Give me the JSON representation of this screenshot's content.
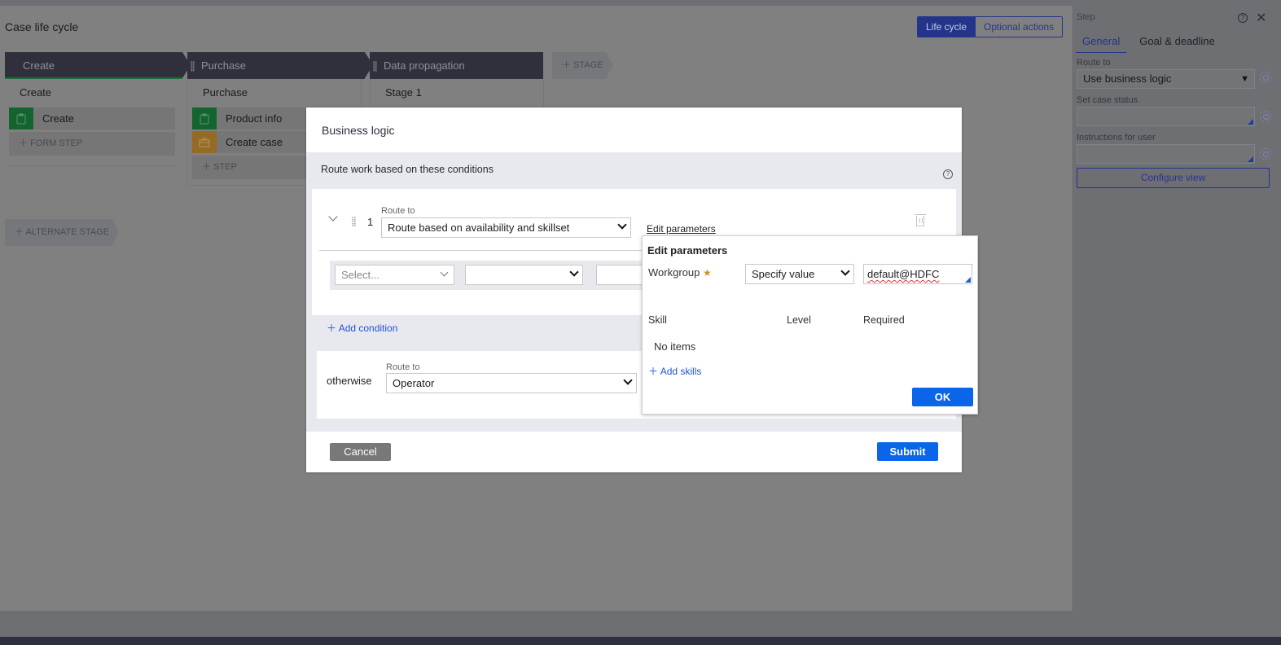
{
  "canvas": {
    "title": "Case life cycle",
    "view_toggle": {
      "active": "Life cycle",
      "inactive": "Optional actions"
    },
    "stages": [
      {
        "name": "Create",
        "processes": [
          {
            "title": "Create",
            "steps": [
              {
                "label": "Create",
                "icon": "clipboard-icon",
                "color": "#13642f"
              }
            ],
            "add_label": "FORM STEP"
          }
        ]
      },
      {
        "name": "Purchase",
        "processes": [
          {
            "title": "Purchase",
            "steps": [
              {
                "label": "Product info",
                "icon": "clipboard-icon",
                "color": "#13642f"
              },
              {
                "label": "Create case",
                "icon": "briefcase-icon",
                "color": "#946a25"
              }
            ],
            "add_label": "STEP"
          }
        ]
      },
      {
        "name": "Data propagation",
        "processes": [
          {
            "title": "Stage 1"
          }
        ]
      }
    ],
    "add_stage_label": "STAGE",
    "add_alternate_stage_label": "ALTERNATE STAGE"
  },
  "panel": {
    "title": "Step",
    "tabs": [
      "General",
      "Goal & deadline"
    ],
    "active_tab": "General",
    "route_to_label": "Route to",
    "route_to_value": "Use business logic",
    "case_status_label": "Set case status",
    "case_status_value": "",
    "instructions_label": "Instructions for user",
    "instructions_value": "",
    "configure_view_label": "Configure view"
  },
  "modal": {
    "title": "Business logic",
    "section_label": "Route work based on these conditions",
    "condition": {
      "index": "1",
      "route_to_label": "Route to",
      "route_to_value": "Route based on availability and skillset",
      "edit_parameters_label": "Edit parameters",
      "field_placeholder": "Select...",
      "operator_value": "",
      "value": ""
    },
    "add_condition_label": "Add condition",
    "otherwise": {
      "label": "otherwise",
      "route_to_label": "Route to",
      "route_to_value": "Operator"
    },
    "cancel_label": "Cancel",
    "submit_label": "Submit"
  },
  "popover": {
    "title": "Edit parameters",
    "workgroup_label": "Workgroup",
    "workgroup_mode": "Specify value",
    "workgroup_value": "default@HDFC",
    "columns": [
      "Skill",
      "Level",
      "Required"
    ],
    "empty_text": "No items",
    "add_skills_label": "Add skills",
    "ok_label": "OK"
  },
  "colors": {
    "primary_button": "#0b65e8",
    "link": "#2253d6",
    "required_star": "#d58a2b",
    "toggle_active": "#23348a"
  }
}
